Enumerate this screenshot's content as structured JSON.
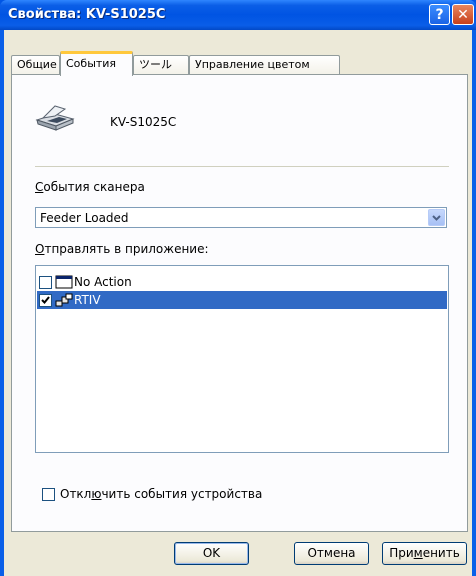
{
  "window": {
    "title": "Свойства: KV-S1025C",
    "help_glyph": "?",
    "close_glyph": "✕"
  },
  "tabs": [
    {
      "label": "Общие",
      "active": false
    },
    {
      "label": "События",
      "active": true
    },
    {
      "label": "ツール",
      "active": false
    },
    {
      "label": "Управление цветом",
      "active": false
    }
  ],
  "device": {
    "name": "KV-S1025C",
    "icon": "scanner-icon"
  },
  "scanner_events": {
    "label_prefix": "",
    "label_accel": "С",
    "label_rest": "обытия сканера",
    "selected": "Feeder Loaded"
  },
  "send_to": {
    "label_accel": "О",
    "label_rest": "тправлять в приложение:",
    "items": [
      {
        "label": "No Action",
        "checked": false,
        "selected": false,
        "icon": "window-icon"
      },
      {
        "label": "RTIV",
        "checked": true,
        "selected": true,
        "icon": "app-icon"
      }
    ]
  },
  "disable_events": {
    "label_before": "Откл",
    "label_accel": "ю",
    "label_after": "чить события устройства",
    "checked": false
  },
  "buttons": {
    "ok": "OK",
    "cancel": "Отмена",
    "apply_before": "При",
    "apply_accel": "м",
    "apply_after": "енить"
  },
  "colors": {
    "title_bar": "#0054e3",
    "selection": "#316ac5",
    "active_tab_accent": "#ffc83c"
  }
}
